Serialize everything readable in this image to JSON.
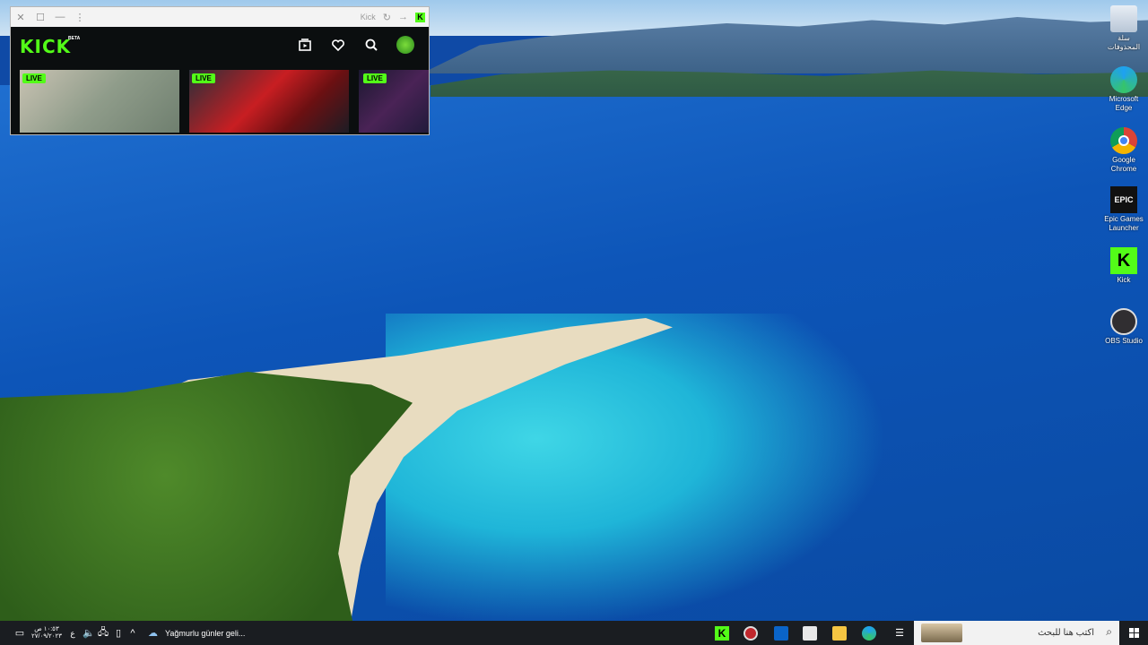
{
  "kick_window": {
    "title": "Kick",
    "logo_text": "KICK",
    "beta_text": "BETA",
    "live_badges": [
      "LIVE",
      "LIVE",
      "LIVE"
    ]
  },
  "desktop_icons": [
    {
      "label": "سلة المحذوفات",
      "icon": "recycle-bin-icon"
    },
    {
      "label": "Microsoft Edge",
      "icon": "edge-icon"
    },
    {
      "label": "Google Chrome",
      "icon": "chrome-icon"
    },
    {
      "label": "Epic Games Launcher",
      "icon": "epic-games-icon",
      "icon_text": "EPIC"
    },
    {
      "label": "Kick",
      "icon": "kick-icon",
      "icon_text": "K"
    },
    {
      "label": "OBS Studio",
      "icon": "obs-icon"
    }
  ],
  "taskbar": {
    "clock_time": "١٠:٥٣ ص",
    "clock_date": "٢٧/٠٩/٢٠٢٣",
    "language": "ع",
    "weather": "Yağmurlu günler geli...",
    "search_placeholder": "اكتب هنا للبحث"
  },
  "colors": {
    "kick_green": "#53fc18",
    "taskbar_bg": "#1a1d21"
  }
}
